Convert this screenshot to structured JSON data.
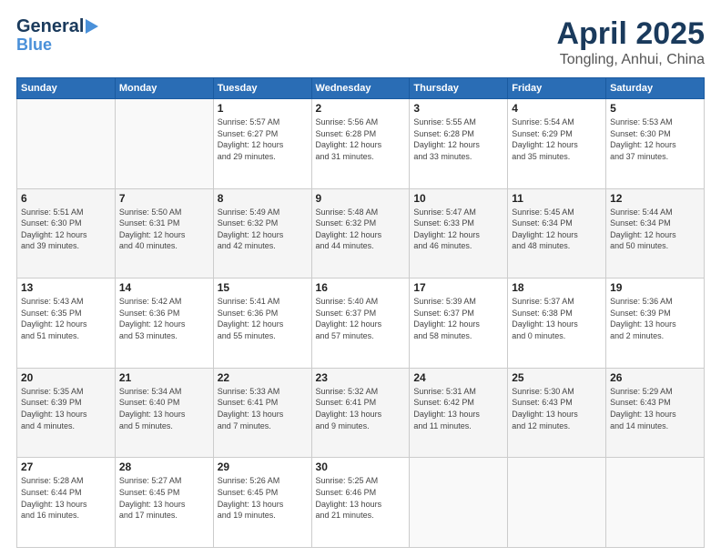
{
  "header": {
    "logo_line1": "General",
    "logo_line2": "Blue",
    "title": "April 2025",
    "subtitle": "Tongling, Anhui, China"
  },
  "weekdays": [
    "Sunday",
    "Monday",
    "Tuesday",
    "Wednesday",
    "Thursday",
    "Friday",
    "Saturday"
  ],
  "weeks": [
    [
      {
        "day": "",
        "info": ""
      },
      {
        "day": "",
        "info": ""
      },
      {
        "day": "1",
        "info": "Sunrise: 5:57 AM\nSunset: 6:27 PM\nDaylight: 12 hours\nand 29 minutes."
      },
      {
        "day": "2",
        "info": "Sunrise: 5:56 AM\nSunset: 6:28 PM\nDaylight: 12 hours\nand 31 minutes."
      },
      {
        "day": "3",
        "info": "Sunrise: 5:55 AM\nSunset: 6:28 PM\nDaylight: 12 hours\nand 33 minutes."
      },
      {
        "day": "4",
        "info": "Sunrise: 5:54 AM\nSunset: 6:29 PM\nDaylight: 12 hours\nand 35 minutes."
      },
      {
        "day": "5",
        "info": "Sunrise: 5:53 AM\nSunset: 6:30 PM\nDaylight: 12 hours\nand 37 minutes."
      }
    ],
    [
      {
        "day": "6",
        "info": "Sunrise: 5:51 AM\nSunset: 6:30 PM\nDaylight: 12 hours\nand 39 minutes."
      },
      {
        "day": "7",
        "info": "Sunrise: 5:50 AM\nSunset: 6:31 PM\nDaylight: 12 hours\nand 40 minutes."
      },
      {
        "day": "8",
        "info": "Sunrise: 5:49 AM\nSunset: 6:32 PM\nDaylight: 12 hours\nand 42 minutes."
      },
      {
        "day": "9",
        "info": "Sunrise: 5:48 AM\nSunset: 6:32 PM\nDaylight: 12 hours\nand 44 minutes."
      },
      {
        "day": "10",
        "info": "Sunrise: 5:47 AM\nSunset: 6:33 PM\nDaylight: 12 hours\nand 46 minutes."
      },
      {
        "day": "11",
        "info": "Sunrise: 5:45 AM\nSunset: 6:34 PM\nDaylight: 12 hours\nand 48 minutes."
      },
      {
        "day": "12",
        "info": "Sunrise: 5:44 AM\nSunset: 6:34 PM\nDaylight: 12 hours\nand 50 minutes."
      }
    ],
    [
      {
        "day": "13",
        "info": "Sunrise: 5:43 AM\nSunset: 6:35 PM\nDaylight: 12 hours\nand 51 minutes."
      },
      {
        "day": "14",
        "info": "Sunrise: 5:42 AM\nSunset: 6:36 PM\nDaylight: 12 hours\nand 53 minutes."
      },
      {
        "day": "15",
        "info": "Sunrise: 5:41 AM\nSunset: 6:36 PM\nDaylight: 12 hours\nand 55 minutes."
      },
      {
        "day": "16",
        "info": "Sunrise: 5:40 AM\nSunset: 6:37 PM\nDaylight: 12 hours\nand 57 minutes."
      },
      {
        "day": "17",
        "info": "Sunrise: 5:39 AM\nSunset: 6:37 PM\nDaylight: 12 hours\nand 58 minutes."
      },
      {
        "day": "18",
        "info": "Sunrise: 5:37 AM\nSunset: 6:38 PM\nDaylight: 13 hours\nand 0 minutes."
      },
      {
        "day": "19",
        "info": "Sunrise: 5:36 AM\nSunset: 6:39 PM\nDaylight: 13 hours\nand 2 minutes."
      }
    ],
    [
      {
        "day": "20",
        "info": "Sunrise: 5:35 AM\nSunset: 6:39 PM\nDaylight: 13 hours\nand 4 minutes."
      },
      {
        "day": "21",
        "info": "Sunrise: 5:34 AM\nSunset: 6:40 PM\nDaylight: 13 hours\nand 5 minutes."
      },
      {
        "day": "22",
        "info": "Sunrise: 5:33 AM\nSunset: 6:41 PM\nDaylight: 13 hours\nand 7 minutes."
      },
      {
        "day": "23",
        "info": "Sunrise: 5:32 AM\nSunset: 6:41 PM\nDaylight: 13 hours\nand 9 minutes."
      },
      {
        "day": "24",
        "info": "Sunrise: 5:31 AM\nSunset: 6:42 PM\nDaylight: 13 hours\nand 11 minutes."
      },
      {
        "day": "25",
        "info": "Sunrise: 5:30 AM\nSunset: 6:43 PM\nDaylight: 13 hours\nand 12 minutes."
      },
      {
        "day": "26",
        "info": "Sunrise: 5:29 AM\nSunset: 6:43 PM\nDaylight: 13 hours\nand 14 minutes."
      }
    ],
    [
      {
        "day": "27",
        "info": "Sunrise: 5:28 AM\nSunset: 6:44 PM\nDaylight: 13 hours\nand 16 minutes."
      },
      {
        "day": "28",
        "info": "Sunrise: 5:27 AM\nSunset: 6:45 PM\nDaylight: 13 hours\nand 17 minutes."
      },
      {
        "day": "29",
        "info": "Sunrise: 5:26 AM\nSunset: 6:45 PM\nDaylight: 13 hours\nand 19 minutes."
      },
      {
        "day": "30",
        "info": "Sunrise: 5:25 AM\nSunset: 6:46 PM\nDaylight: 13 hours\nand 21 minutes."
      },
      {
        "day": "",
        "info": ""
      },
      {
        "day": "",
        "info": ""
      },
      {
        "day": "",
        "info": ""
      }
    ]
  ]
}
